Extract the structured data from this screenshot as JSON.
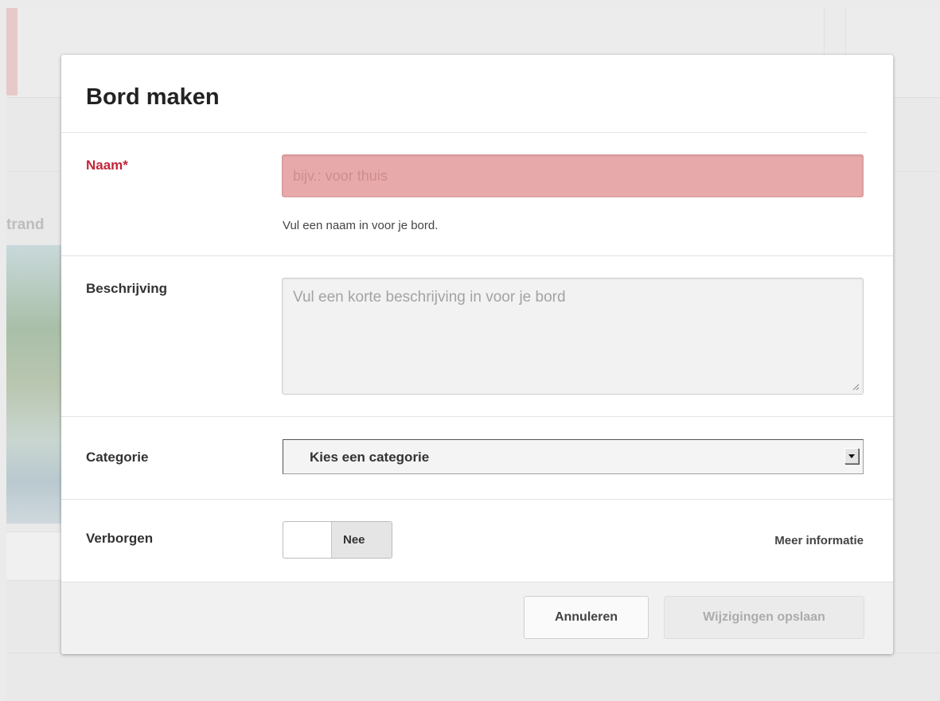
{
  "background": {
    "partial_text": "trand"
  },
  "modal": {
    "title": "Bord maken",
    "name": {
      "label": "Naam*",
      "placeholder": "bijv.: voor thuis",
      "value": "",
      "hint": "Vul een naam in voor je bord."
    },
    "description": {
      "label": "Beschrijving",
      "placeholder": "Vul een korte beschrijving in voor je bord",
      "value": ""
    },
    "category": {
      "label": "Categorie",
      "selected": "Kies een categorie"
    },
    "hidden": {
      "label": "Verborgen",
      "toggle_state": "Nee",
      "more_info": "Meer informatie"
    },
    "footer": {
      "cancel_label": "Annuleren",
      "save_label": "Wijzigingen opslaan"
    }
  },
  "colors": {
    "required_label": "#c3263b",
    "error_input_bg": "#e8a9ab",
    "disabled_text": "#acacac"
  }
}
